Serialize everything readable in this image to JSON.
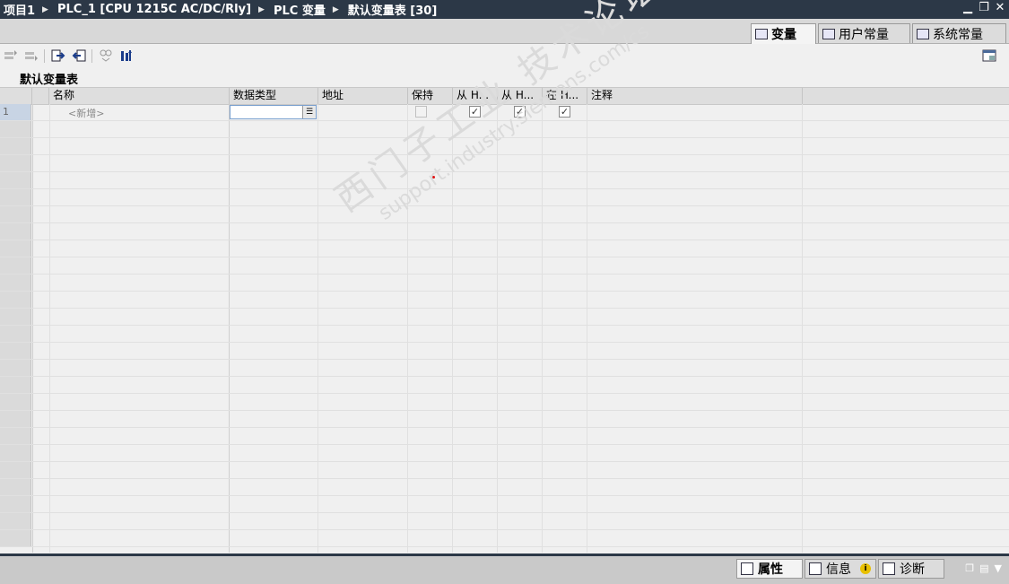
{
  "window": {
    "breadcrumb": [
      "项目1",
      "PLC_1 [CPU 1215C AC/DC/Rly]",
      "PLC 变量",
      "默认变量表 [30]"
    ],
    "controls": [
      "minimize-icon",
      "restore-icon",
      "close-icon"
    ]
  },
  "top_tabs": [
    {
      "label": "变量",
      "active": true
    },
    {
      "label": "用户常量",
      "active": false
    },
    {
      "label": "系统常量",
      "active": false
    }
  ],
  "toolbar": {
    "icons": [
      "insert-row-icon",
      "add-row-icon",
      "export-icon",
      "import-icon",
      "monitor-icon",
      "go-online-icon",
      "split-view-icon"
    ]
  },
  "table": {
    "title": "默认变量表",
    "columns": [
      "名称",
      "数据类型",
      "地址",
      "保持",
      "从 H...",
      "从 H...",
      "在 H...",
      "注释"
    ],
    "first_row": {
      "number": "1",
      "name_placeholder": "<新增>",
      "data_type": "",
      "address": "",
      "retain": false,
      "from_hmi_1": true,
      "from_hmi_2": true,
      "in_hmi": true,
      "comment": ""
    },
    "empty_rows": 25
  },
  "watermark": {
    "line1": "西门子工业 技术论坛",
    "line2": "support.industry.siemens.com/cs"
  },
  "bottom_tabs": [
    {
      "label": "属性",
      "active": true
    },
    {
      "label": "信息",
      "active": false,
      "badge": "i"
    },
    {
      "label": "诊断",
      "active": false
    }
  ]
}
